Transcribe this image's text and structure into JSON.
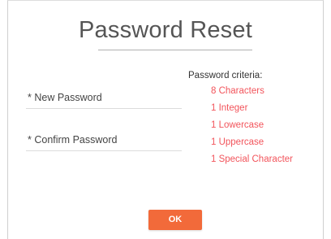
{
  "dialog": {
    "title": "Password Reset",
    "fields": {
      "new_password": {
        "label": "* New Password",
        "value": ""
      },
      "confirm_password": {
        "label": "* Confirm Password",
        "value": ""
      }
    },
    "criteria": {
      "title": "Password criteria:",
      "items": [
        "8 Characters",
        "1 Integer",
        "1 Lowercase",
        "1 Uppercase",
        "1 Special Character"
      ]
    },
    "ok_label": "OK"
  },
  "colors": {
    "accent": "#f26a3a",
    "criteria_unmet": "#f2545b"
  }
}
